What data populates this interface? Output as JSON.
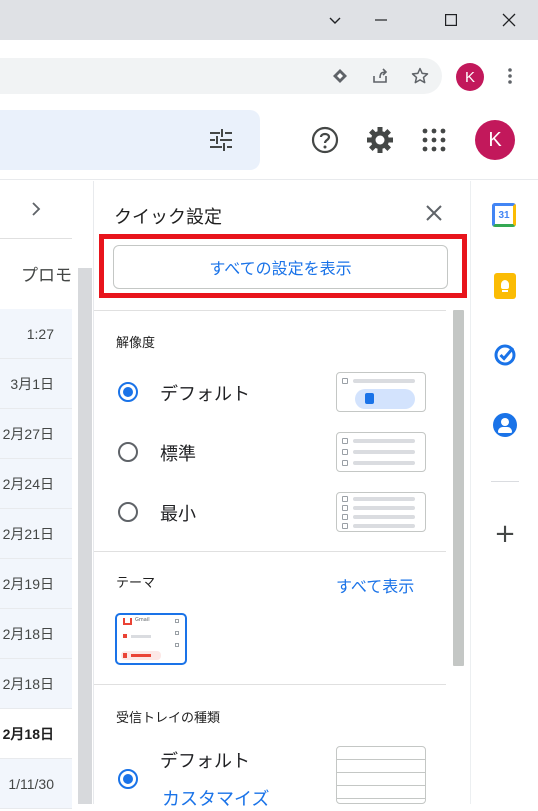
{
  "browser": {
    "window_controls": {
      "minimize": "—",
      "maximize": "☐",
      "close": "✕"
    },
    "profile_initial": "K"
  },
  "gmail": {
    "profile_initial": "K",
    "tab_label": "プロモ"
  },
  "mail_dates": [
    "1:27",
    "3月1日",
    "2月27日",
    "2月24日",
    "2月21日",
    "2月19日",
    "2月18日",
    "2月18日",
    "2月18日",
    "1/11/30"
  ],
  "quick_settings": {
    "title": "クイック設定",
    "all_settings_button": "すべての設定を表示",
    "density": {
      "heading": "解像度",
      "options": [
        {
          "label": "デフォルト",
          "selected": true
        },
        {
          "label": "標準",
          "selected": false
        },
        {
          "label": "最小",
          "selected": false
        }
      ]
    },
    "theme": {
      "heading": "テーマ",
      "view_all": "すべて表示",
      "thumb_brand": "Gmail"
    },
    "inbox": {
      "heading": "受信トレイの種類",
      "option_label": "デフォルト",
      "customize": "カスタマイズ"
    }
  },
  "side_panel": {
    "calendar_day": "31",
    "add": "+"
  },
  "colors": {
    "accent": "#1a73e8",
    "highlight_box": "#e8141c",
    "avatar": "#c2185b",
    "keep": "#fbbc04"
  }
}
